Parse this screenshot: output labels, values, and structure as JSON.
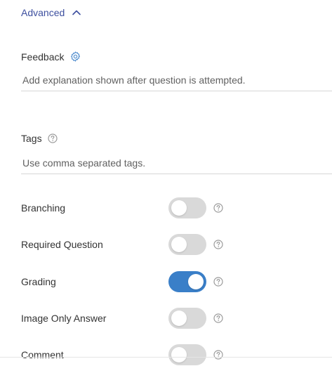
{
  "advanced": {
    "label": "Advanced",
    "expanded": true
  },
  "feedback": {
    "label": "Feedback",
    "placeholder": "Add explanation shown after question is attempted.",
    "value": ""
  },
  "tags": {
    "label": "Tags",
    "placeholder": "Use comma separated tags.",
    "value": ""
  },
  "toggles": [
    {
      "label": "Branching",
      "on": false
    },
    {
      "label": "Required Question",
      "on": false
    },
    {
      "label": "Grading",
      "on": true
    },
    {
      "label": "Image Only Answer",
      "on": false
    },
    {
      "label": "Comment",
      "on": false
    }
  ],
  "colors": {
    "accent": "#3a7fc8",
    "link": "#3d4f9f",
    "switch_off": "#d9d9d9"
  }
}
